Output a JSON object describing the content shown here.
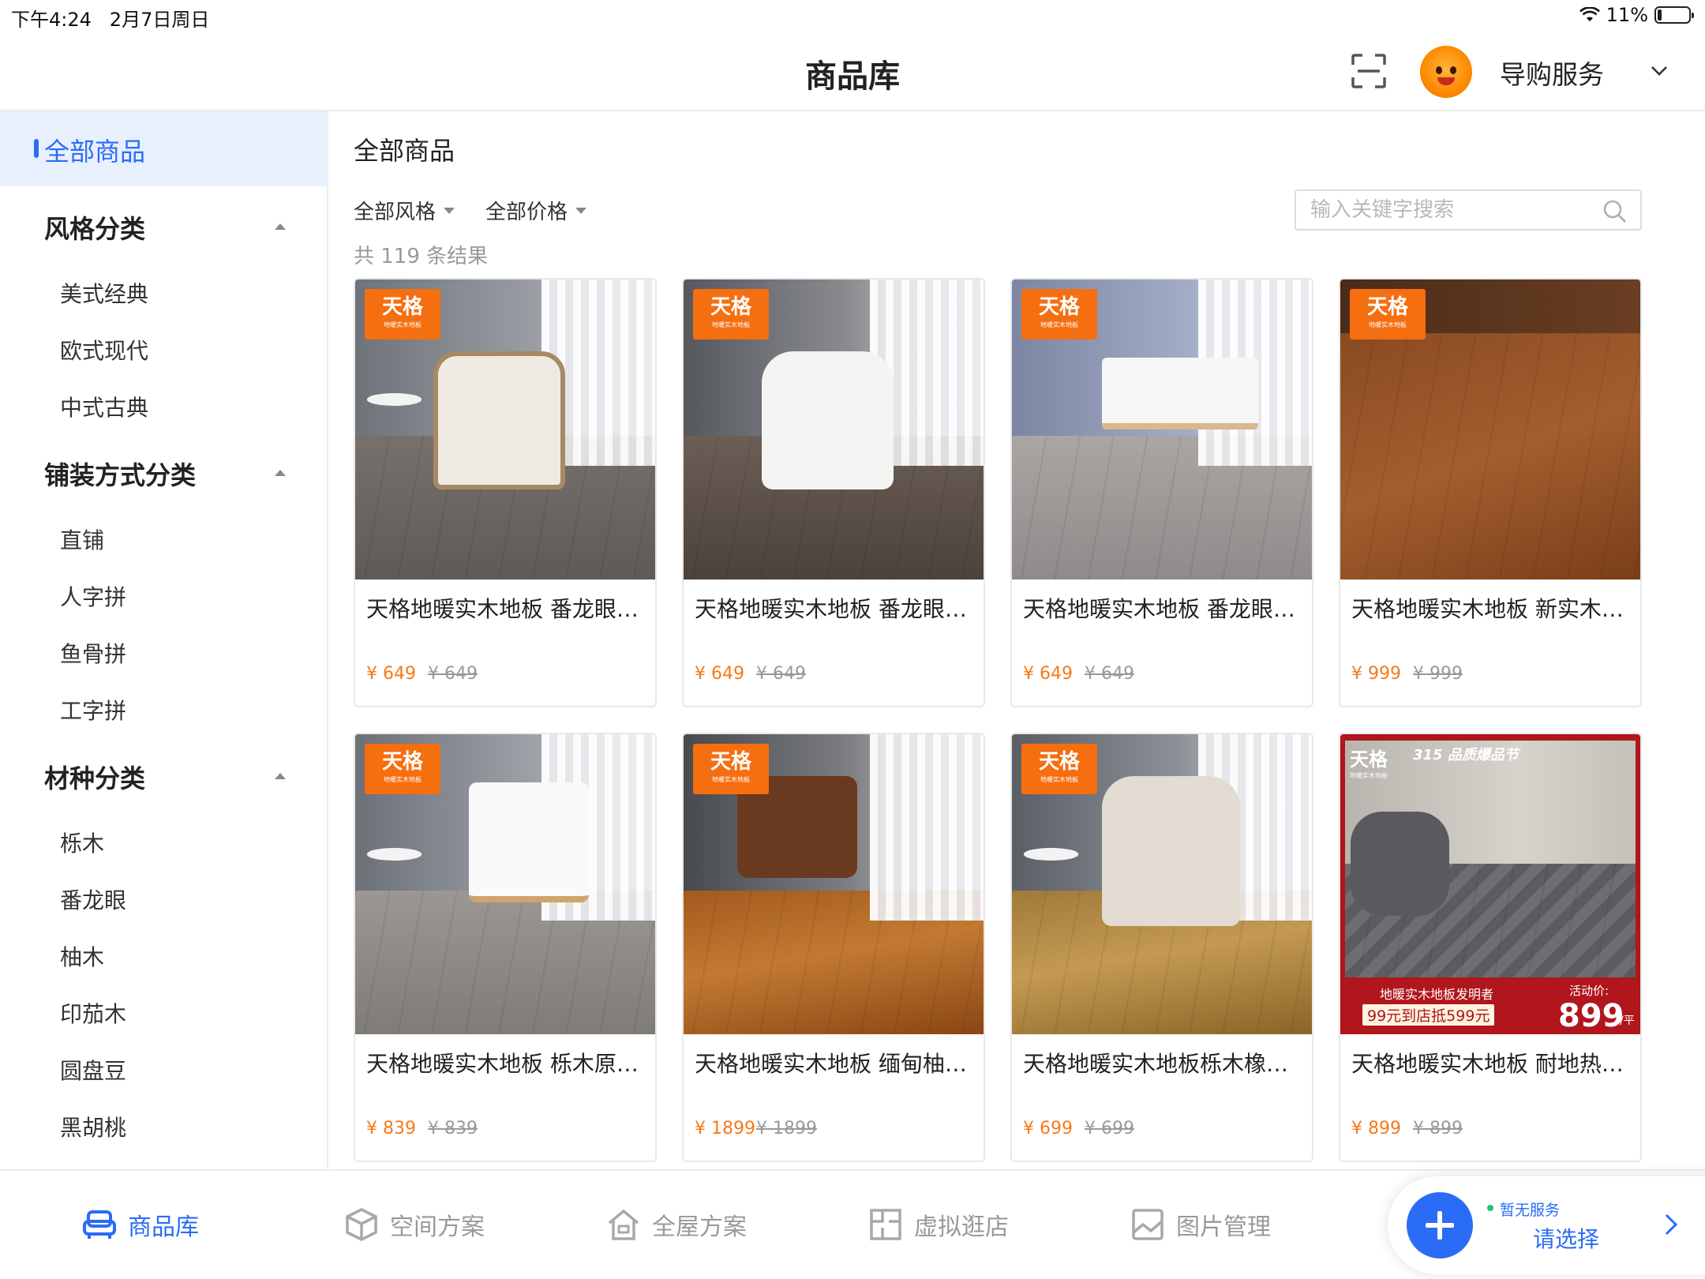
{
  "status_bar": {
    "time": "下午4:24",
    "date": "2月7日周日",
    "battery": "11%"
  },
  "header": {
    "title": "商品库",
    "service_label": "导购服务"
  },
  "sidebar": {
    "all_label": "全部商品",
    "groups": [
      {
        "title": "风格分类",
        "items": [
          "美式经典",
          "欧式现代",
          "中式古典"
        ]
      },
      {
        "title": "铺装方式分类",
        "items": [
          "直铺",
          "人字拼",
          "鱼骨拼",
          "工字拼"
        ]
      },
      {
        "title": "材种分类",
        "items": [
          "栎木",
          "番龙眼",
          "柚木",
          "印茄木",
          "圆盘豆",
          "黑胡桃"
        ]
      }
    ]
  },
  "main": {
    "title": "全部商品",
    "filters": [
      "全部风格",
      "全部价格"
    ],
    "search_placeholder": "输入关键字搜索",
    "result_count": "共 119 条结果"
  },
  "products": [
    {
      "title": "天格地暖实木地板 番龙眼…",
      "price": "¥ 649",
      "original_price": "¥ 649",
      "badge": "天格",
      "badge_sub": "地暖实木地板"
    },
    {
      "title": "天格地暖实木地板 番龙眼…",
      "price": "¥ 649",
      "original_price": "¥ 649",
      "badge": "天格",
      "badge_sub": "地暖实木地板"
    },
    {
      "title": "天格地暖实木地板 番龙眼…",
      "price": "¥ 649",
      "original_price": "¥ 649",
      "badge": "天格",
      "badge_sub": "地暖实木地板"
    },
    {
      "title": "天格地暖实木地板 新实木…",
      "price": "¥ 999",
      "original_price": "¥ 999",
      "badge": "天格",
      "badge_sub": "地暖实木地板"
    },
    {
      "title": "天格地暖实木地板 栎木原…",
      "price": "¥ 839",
      "original_price": "¥ 839",
      "badge": "天格",
      "badge_sub": "地暖实木地板"
    },
    {
      "title": "天格地暖实木地板 缅甸柚…",
      "price": "¥ 1899",
      "original_price": "¥ 1899",
      "badge": "天格",
      "badge_sub": "地暖实木地板"
    },
    {
      "title": "天格地暖实木地板栎木橡…",
      "price": "¥ 699",
      "original_price": "¥ 699",
      "badge": "天格",
      "badge_sub": "地暖实木地板"
    },
    {
      "title": "天格地暖实木地板 耐地热…",
      "price": "¥ 899",
      "original_price": "¥ 899"
    }
  ],
  "promo": {
    "brand": "天格",
    "brand_sub": "地暖实木地板",
    "event": "315 品质爆品节",
    "inventor": "地暖实木地板发明者",
    "coupon": "99元到店抵599元",
    "price_label": "活动价:",
    "price": "899",
    "unit": "/平"
  },
  "tabs": [
    {
      "label": "商品库",
      "active": true
    },
    {
      "label": "空间方案",
      "active": false
    },
    {
      "label": "全屋方案",
      "active": false
    },
    {
      "label": "虚拟逛店",
      "active": false
    },
    {
      "label": "图片管理",
      "active": false
    }
  ],
  "guide": {
    "status": "暂无服务",
    "select_label": "请选择"
  },
  "colors": {
    "accent": "#2a6cf6",
    "price": "#f57a1a",
    "brand_badge": "#f56e10",
    "promo_red": "#b0161c"
  }
}
